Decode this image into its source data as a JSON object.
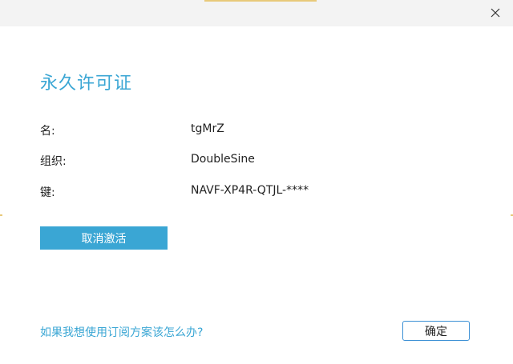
{
  "window": {
    "close_icon": "close-icon"
  },
  "license": {
    "title": "永久许可证",
    "fields": [
      {
        "label": "名:",
        "value": "tgMrZ"
      },
      {
        "label": "组织:",
        "value": "DoubleSine"
      },
      {
        "label": "键:",
        "value": "NAVF-XP4R-QTJL-****"
      }
    ],
    "deactivate_label": "取消激活"
  },
  "footer": {
    "help_link": "如果我想使用订阅方案该怎么办?",
    "ok_label": "确定"
  },
  "colors": {
    "accent": "#3aa6d4",
    "titlebar_bg": "#f3f3f3",
    "ok_border": "#3a8fd4"
  }
}
